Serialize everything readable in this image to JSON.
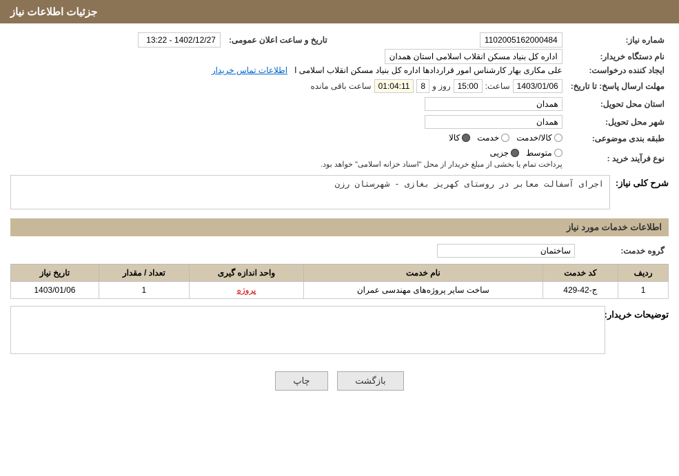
{
  "page": {
    "title": "جزئیات اطلاعات نیاز",
    "header_bg": "#8b7355"
  },
  "fields": {
    "need_number_label": "شماره نیاز:",
    "need_number_value": "1102005162000484",
    "buyer_org_label": "نام دستگاه خریدار:",
    "buyer_org_value": "اداره کل بنیاد مسکن انقلاب اسلامی استان همدان",
    "creator_label": "ایجاد کننده درخواست:",
    "creator_value": "علی مکاری بهار کارشناس امور قراردادها اداره کل بنیاد مسکن انقلاب اسلامی ا",
    "creator_link": "اطلاعات تماس خریدار",
    "deadline_label": "مهلت ارسال پاسخ: تا تاریخ:",
    "date_value": "1403/01/06",
    "time_label": "ساعت:",
    "time_value": "15:00",
    "day_label": "روز و",
    "days_value": "8",
    "remaining_label": "ساعت باقی مانده",
    "remaining_value": "01:04:11",
    "province_label": "استان محل تحویل:",
    "province_value": "همدان",
    "city_label": "شهر محل تحویل:",
    "city_value": "همدان",
    "category_label": "طبقه بندی موضوعی:",
    "category_kala": "کالا",
    "category_khadamat": "خدمت",
    "category_kala_khadamat": "کالا/خدمت",
    "purchase_type_label": "نوع فرآیند خرید :",
    "purchase_jozii": "جزیی",
    "purchase_motavasset": "متوسط",
    "purchase_note": "پرداخت تمام یا بخشی از مبلغ خریدار از محل \"اسناد خزانه اسلامی\" خواهد بود.",
    "description_label": "شرح کلی نیاز:",
    "description_value": "اجرای آسفالت معابر در روستای کهریز بغازی - شهرستان رزن",
    "services_section_title": "اطلاعات خدمات مورد نیاز",
    "service_group_label": "گروه خدمت:",
    "service_group_value": "ساختمان",
    "table_headers": {
      "row_num": "ردیف",
      "service_code": "کد خدمت",
      "service_name": "نام خدمت",
      "unit": "واحد اندازه گیری",
      "quantity": "تعداد / مقدار",
      "date": "تاریخ نیاز"
    },
    "table_rows": [
      {
        "row_num": "1",
        "service_code": "ج-42-429",
        "service_name": "ساخت سایر پروژه‌های مهندسی عمران",
        "unit": "پروژه",
        "quantity": "1",
        "date": "1403/01/06"
      }
    ],
    "buyer_notes_label": "توضیحات خریدار:",
    "buyer_notes_value": "",
    "btn_print": "چاپ",
    "btn_back": "بازگشت",
    "announce_date_label": "تاریخ و ساعت اعلان عمومی:",
    "announce_date_value": "1402/12/27 - 13:22"
  }
}
